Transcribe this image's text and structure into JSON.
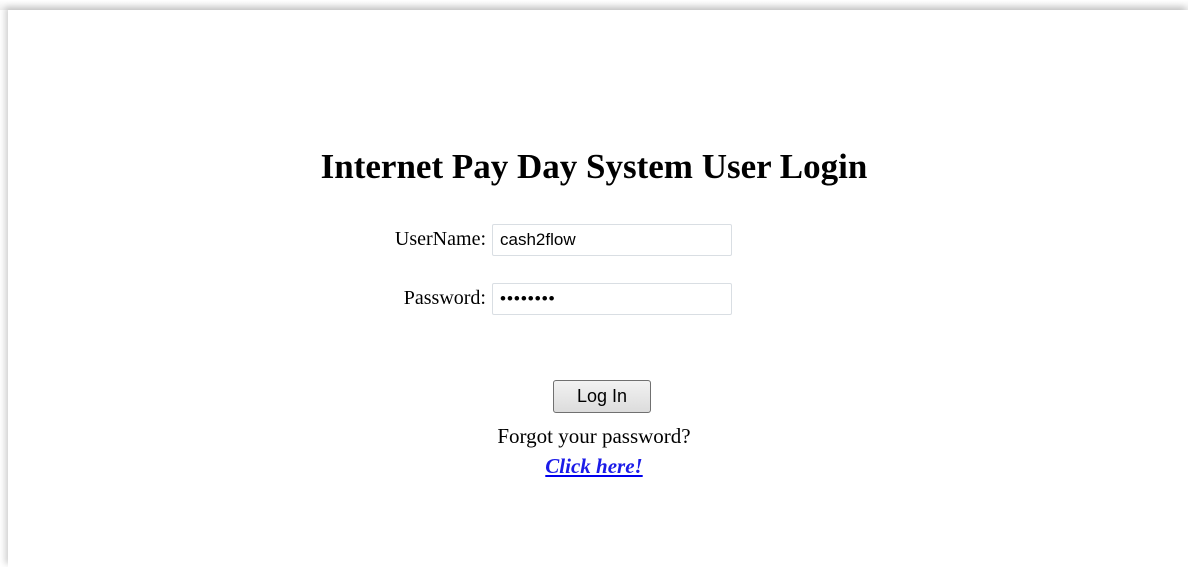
{
  "login": {
    "title": "Internet Pay Day System User Login",
    "username_label": "UserName:",
    "username_value": "cash2flow",
    "password_label": "Password:",
    "password_value": "cash2flw",
    "login_button": "Log In",
    "forgot_text": "Forgot your password?",
    "click_here_link": "Click here!"
  },
  "colors": {
    "link": "#1b1be8",
    "input_border": "#d9dee3"
  }
}
